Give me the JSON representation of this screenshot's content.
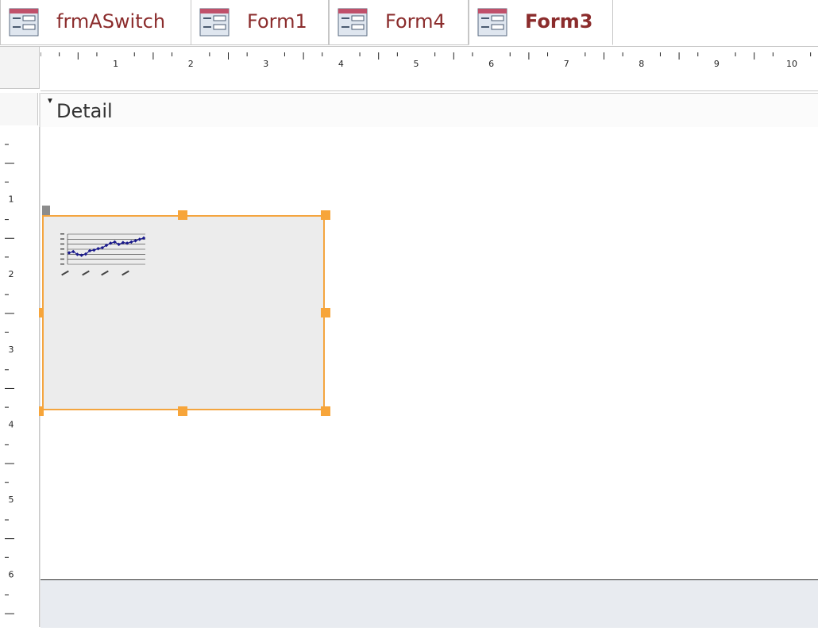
{
  "tabs": [
    {
      "label": "frmASwitch",
      "active": false
    },
    {
      "label": "Form1",
      "active": false
    },
    {
      "label": "Form4",
      "active": false
    },
    {
      "label": "Form3",
      "active": true
    }
  ],
  "ruler": {
    "horizontal": [
      "1",
      "2",
      "3",
      "4",
      "5",
      "6",
      "7",
      "8",
      "9",
      "10"
    ],
    "vertical": [
      "1",
      "2",
      "3",
      "4",
      "5",
      "6"
    ]
  },
  "section": {
    "label": "Detail"
  },
  "colors": {
    "tab_text": "#8b2c2c",
    "selection": "#f4a53f",
    "chart_series": "#1a1a8c"
  },
  "chart_data": {
    "type": "line",
    "title": "",
    "xlabel": "",
    "ylabel": "",
    "series": [
      {
        "values": [
          0.38,
          0.42,
          0.33,
          0.3,
          0.34,
          0.45,
          0.47,
          0.52,
          0.55,
          0.63,
          0.7,
          0.74,
          0.66,
          0.72,
          0.7,
          0.74,
          0.78,
          0.83,
          0.87
        ]
      }
    ],
    "grid": true,
    "legend": "none"
  }
}
